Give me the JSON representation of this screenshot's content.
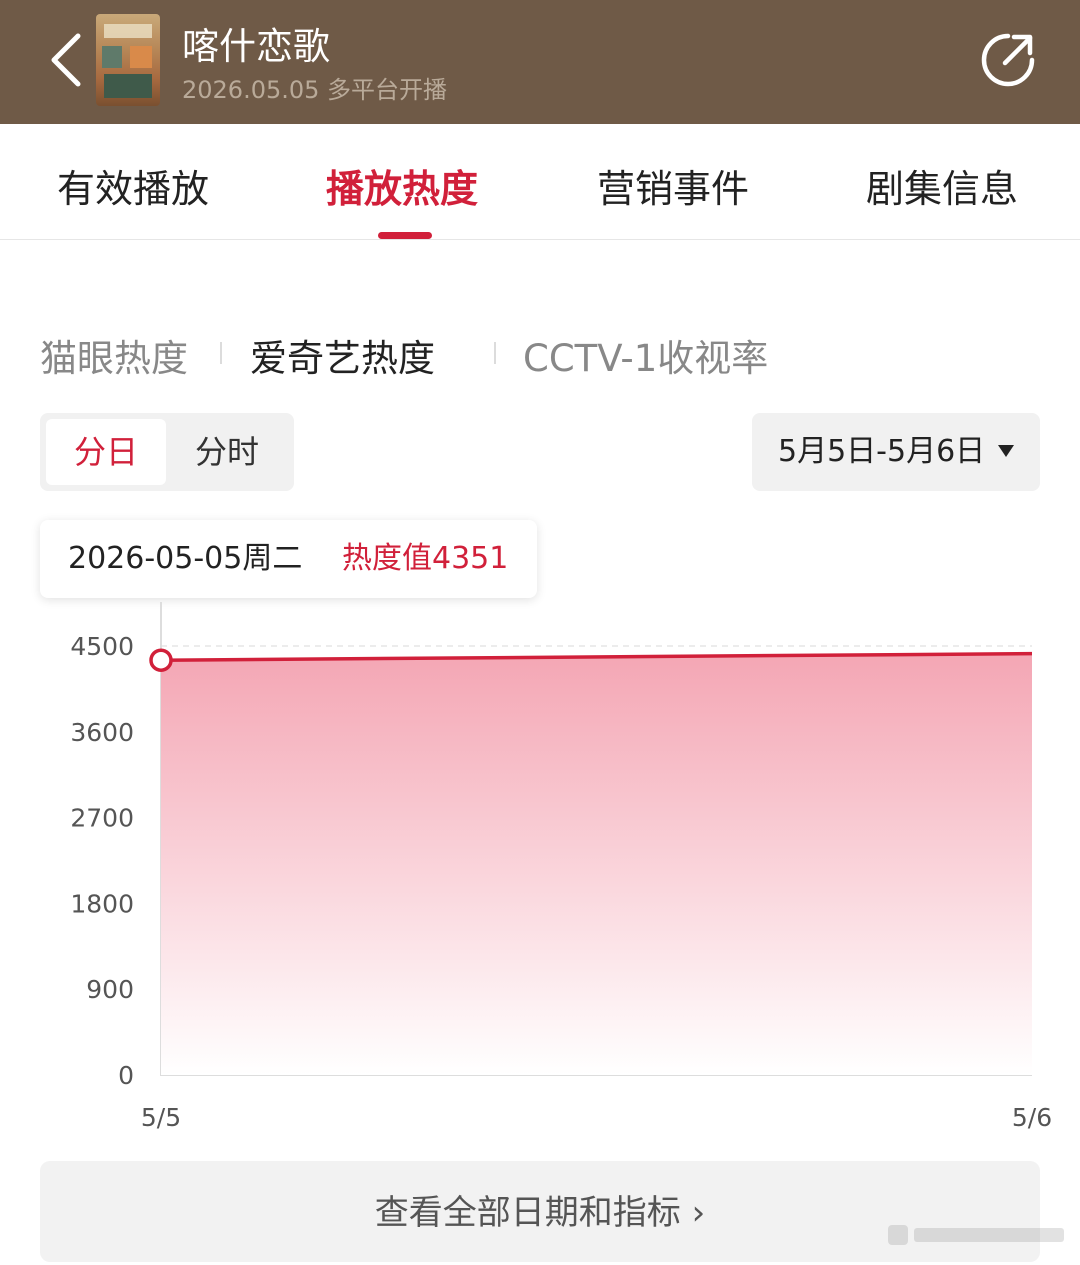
{
  "header": {
    "title": "喀什恋歌",
    "subtitle": "2026.05.05 多平台开播",
    "back_icon": "chevron-left-icon",
    "share_icon": "share-icon"
  },
  "tabs": [
    {
      "label": "有效播放",
      "active": false
    },
    {
      "label": "播放热度",
      "active": true
    },
    {
      "label": "营销事件",
      "active": false
    },
    {
      "label": "剧集信息",
      "active": false
    }
  ],
  "sub_tabs": [
    {
      "label": "猫眼热度",
      "active": false
    },
    {
      "label": "爱奇艺热度",
      "active": true
    },
    {
      "label": "CCTV-1收视率",
      "active": false
    }
  ],
  "granularity": [
    {
      "label": "分日",
      "active": true
    },
    {
      "label": "分时",
      "active": false
    }
  ],
  "date_range": {
    "label": "5月5日-5月6日"
  },
  "tooltip": {
    "date": "2026-05-05周二",
    "value_label": "热度值4351"
  },
  "colors": {
    "accent": "#d1203a",
    "header_bg": "#6f5a47",
    "area_top": "#f4a6b4",
    "area_bottom": "#ffffff"
  },
  "chart_data": {
    "type": "area",
    "x": [
      "5/5",
      "5/6"
    ],
    "values": [
      4351,
      4420
    ],
    "yticks": [
      0,
      900,
      1800,
      2700,
      3600,
      4500
    ],
    "ylim": [
      0,
      4500
    ],
    "grid": true,
    "highlighted_index": 0
  },
  "footer": {
    "more_label": "查看全部日期和指标 ›"
  }
}
